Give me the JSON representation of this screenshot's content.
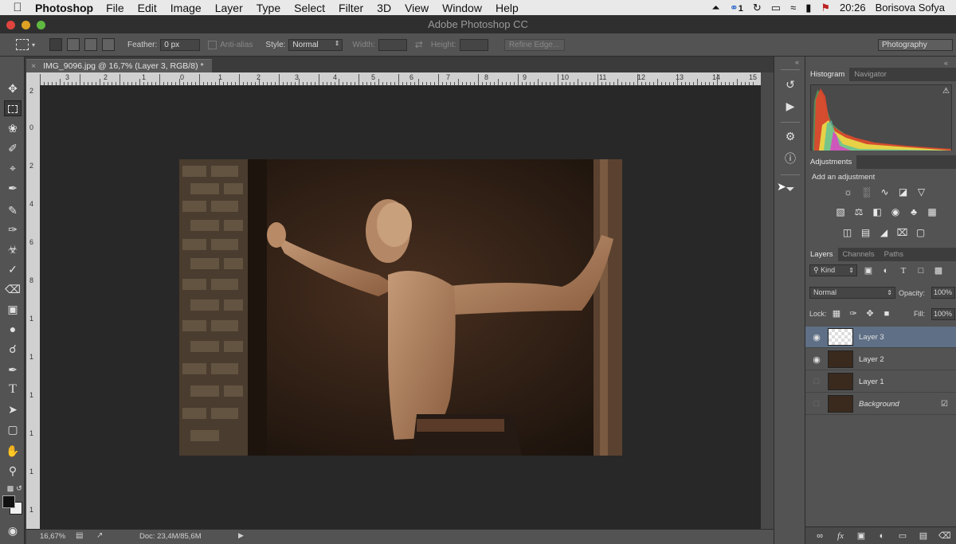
{
  "menubar": {
    "app": "Photoshop",
    "items": [
      "File",
      "Edit",
      "Image",
      "Layer",
      "Type",
      "Select",
      "Filter",
      "3D",
      "View",
      "Window",
      "Help"
    ],
    "notification_count": "1",
    "time": "20:26",
    "user": "Borisova Sofya"
  },
  "window": {
    "title": "Adobe Photoshop CC"
  },
  "options": {
    "feather_label": "Feather:",
    "feather_value": "0 px",
    "anti_alias_label": "Anti-alias",
    "style_label": "Style:",
    "style_value": "Normal",
    "width_label": "Width:",
    "height_label": "Height:",
    "refine_edge_label": "Refine Edge...",
    "workspace": "Photography"
  },
  "document": {
    "tab_title": "IMG_9096.jpg @ 16,7% (Layer 3, RGB/8) *",
    "ruler_h_labels": [
      "3",
      "2",
      "1",
      "0",
      "1",
      "2",
      "3",
      "4",
      "5",
      "6",
      "7",
      "8",
      "9",
      "10",
      "11",
      "12",
      "13",
      "14",
      "15"
    ],
    "ruler_v_labels": [
      "2",
      "0",
      "2",
      "4",
      "6",
      "8",
      "1",
      "1",
      "1",
      "1",
      "1",
      "1",
      "1",
      "2",
      "2"
    ],
    "zoom": "16,67%",
    "doc_info": "Doc: 23,4M/85,6M"
  },
  "panels": {
    "histogram_tab": "Histogram",
    "navigator_tab": "Navigator",
    "adjustments_tab": "Adjustments",
    "add_adjustment": "Add an adjustment",
    "layers_tab": "Layers",
    "channels_tab": "Channels",
    "paths_tab": "Paths",
    "kind_label": "Kind",
    "blend_mode": "Normal",
    "opacity_label": "Opacity:",
    "opacity_value": "100%",
    "lock_label": "Lock:",
    "fill_label": "Fill:",
    "fill_value": "100%",
    "layers": [
      {
        "name": "Layer 3",
        "visible": true,
        "selected": true
      },
      {
        "name": "Layer 2",
        "visible": true,
        "selected": false
      },
      {
        "name": "Layer 1",
        "visible": false,
        "selected": false
      },
      {
        "name": "Background",
        "visible": false,
        "selected": false,
        "locked": true
      }
    ]
  },
  "colors": {
    "accent_selected_layer": "#5e6f86",
    "panel_bg": "#535353",
    "canvas_bg": "#282828"
  }
}
